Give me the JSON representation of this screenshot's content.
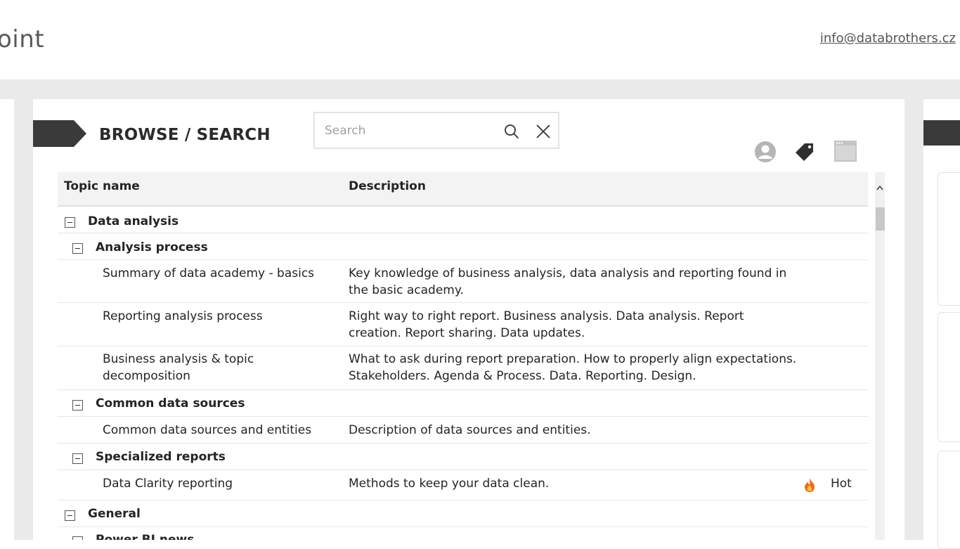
{
  "app": {
    "title_fragment": "oint",
    "contact_email": "info@databrothers.cz"
  },
  "header": {
    "title": "BROWSE / SEARCH"
  },
  "search": {
    "placeholder": "Search",
    "value": ""
  },
  "icons": {
    "user": "user-circle-icon",
    "tag": "tag-icon",
    "window": "browser-window-icon",
    "search": "search-icon",
    "clear": "close-icon",
    "hot": "fire-icon"
  },
  "table": {
    "columns": {
      "topic": "Topic name",
      "description": "Description"
    },
    "rows": [
      {
        "level": 0,
        "type": "group",
        "topic": "Data analysis"
      },
      {
        "level": 1,
        "type": "group",
        "topic": "Analysis process"
      },
      {
        "level": 2,
        "type": "item",
        "topic": "Summary of data academy - basics",
        "description": "Key knowledge of business analysis, data analysis and reporting found in the basic academy."
      },
      {
        "level": 2,
        "type": "item",
        "topic": "Reporting analysis process",
        "description": "Right way to right report. Business analysis. Data analysis. Report creation. Report sharing. Data updates."
      },
      {
        "level": 2,
        "type": "item",
        "topic": "Business analysis & topic decomposition",
        "description": "What to ask during report preparation. How to properly align expectations. Stakeholders. Agenda & Process. Data. Reporting. Design."
      },
      {
        "level": 1,
        "type": "group",
        "topic": "Common data sources"
      },
      {
        "level": 2,
        "type": "item",
        "topic": "Common data sources and entities",
        "description": "Description of data sources and entities."
      },
      {
        "level": 1,
        "type": "group",
        "topic": "Specialized reports"
      },
      {
        "level": 2,
        "type": "item",
        "topic": "Data Clarity reporting",
        "description": "Methods to keep your data clean.",
        "tag": "Hot"
      },
      {
        "level": 0,
        "type": "group",
        "topic": "General"
      },
      {
        "level": 1,
        "type": "group",
        "topic": "Power BI news"
      }
    ]
  },
  "colors": {
    "header_band": "#3a3a3a",
    "canvas_bg": "#eaeaea",
    "table_header_bg": "#f3f3f3",
    "hot_flame": "#f26b1d"
  }
}
